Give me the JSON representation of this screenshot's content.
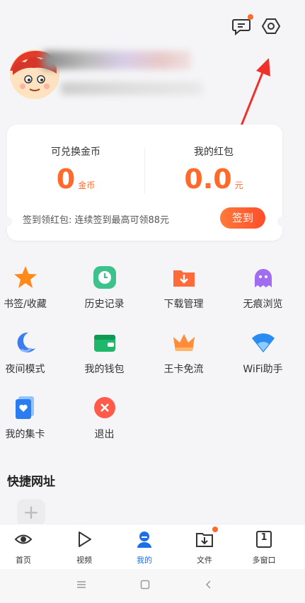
{
  "header": {
    "message_icon": "message-bubble-icon",
    "settings_icon": "hexagon-settings-icon"
  },
  "wallet": {
    "coins_label": "可兑换金币",
    "coins_value": "0",
    "coins_unit": "金币",
    "redpacket_label": "我的红包",
    "redpacket_value": "0.0",
    "redpacket_unit": "元",
    "sign_text": "签到领红包: 连续签到最高可领88元",
    "sign_button": "签到"
  },
  "features": [
    {
      "label": "书签/收藏",
      "icon": "star-icon"
    },
    {
      "label": "历史记录",
      "icon": "clock-icon"
    },
    {
      "label": "下载管理",
      "icon": "download-folder-icon"
    },
    {
      "label": "无痕浏览",
      "icon": "ghost-icon"
    },
    {
      "label": "夜间模式",
      "icon": "moon-icon"
    },
    {
      "label": "我的钱包",
      "icon": "wallet-icon"
    },
    {
      "label": "王卡免流",
      "icon": "crown-icon"
    },
    {
      "label": "WiFi助手",
      "icon": "wifi-icon"
    },
    {
      "label": "我的集卡",
      "icon": "card-icon"
    },
    {
      "label": "退出",
      "icon": "exit-icon"
    }
  ],
  "shortcuts": {
    "title": "快捷网址",
    "add_label": "+"
  },
  "tabs": [
    {
      "label": "首页",
      "icon": "eye-icon"
    },
    {
      "label": "视频",
      "icon": "play-icon"
    },
    {
      "label": "我的",
      "icon": "person-icon",
      "active": true
    },
    {
      "label": "文件",
      "icon": "file-folder-icon"
    },
    {
      "label": "多窗口",
      "icon": "windows-icon",
      "count": "1"
    }
  ],
  "colors": {
    "accent": "#ff6a2a",
    "active_tab": "#1d6fe8"
  }
}
